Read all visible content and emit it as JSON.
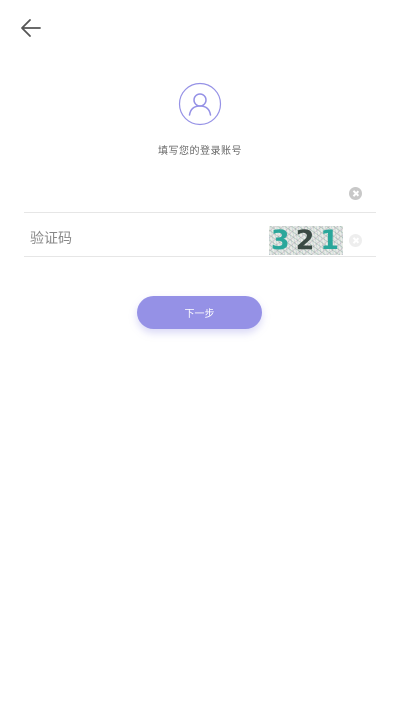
{
  "header": {
    "back_icon": "arrow-left-icon"
  },
  "profile": {
    "avatar_icon": "user-outline-icon",
    "accent_color": "#9591e6",
    "subtitle": "填写您的登录账号"
  },
  "account_field": {
    "value": "",
    "placeholder": "",
    "clear_icon": "clear-circle-icon"
  },
  "captcha_field": {
    "value": "",
    "placeholder": "验证码",
    "captcha_chars": [
      "3",
      "2",
      "1"
    ],
    "clear_icon": "clear-circle-icon"
  },
  "actions": {
    "next_label": "下一步",
    "next_color": "#9591e6"
  }
}
